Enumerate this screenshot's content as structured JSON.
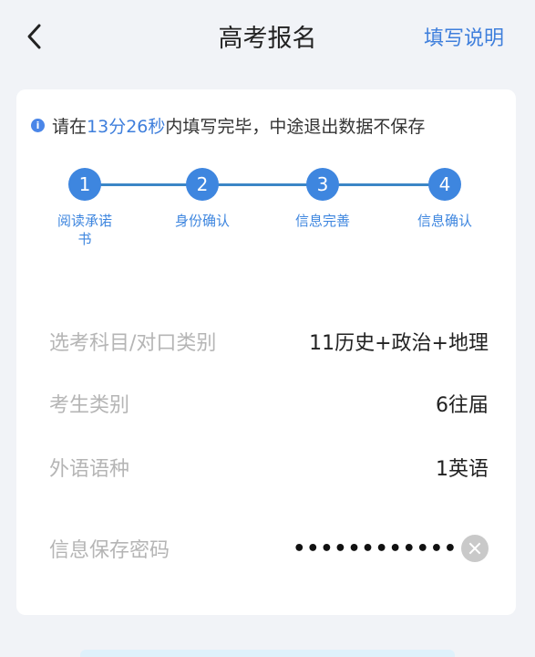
{
  "header": {
    "title": "高考报名",
    "help_link": "填写说明"
  },
  "notice": {
    "prefix": "请在",
    "time": "13分26秒",
    "suffix": "内填写完毕，中途退出数据不保存"
  },
  "steps": [
    {
      "number": "1",
      "label": "阅读承诺书"
    },
    {
      "number": "2",
      "label": "身份确认"
    },
    {
      "number": "3",
      "label": "信息完善"
    },
    {
      "number": "4",
      "label": "信息确认"
    }
  ],
  "fields": {
    "subjects": {
      "label": "选考科目/对口类别",
      "value": "11历史+政治+地理"
    },
    "candidate_type": {
      "label": "考生类别",
      "value": "6往届"
    },
    "language": {
      "label": "外语语种",
      "value": "1英语"
    },
    "password": {
      "label": "信息保存密码",
      "value": "••••••••••••"
    }
  },
  "colors": {
    "accent": "#3e86df",
    "link": "#3f7fdc",
    "label_gray": "#b5b5b5"
  },
  "icons": {
    "back": "chevron-left-icon",
    "info": "info-icon",
    "clear": "clear-icon"
  }
}
